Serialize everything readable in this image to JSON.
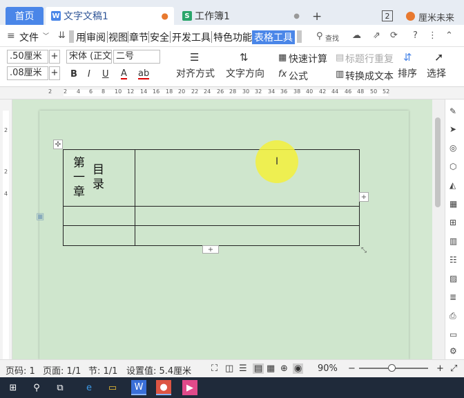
{
  "tabs": {
    "home": "首页",
    "doc": "文字文稿1",
    "sheet": "工作簿1",
    "add": "+",
    "window_count": "2",
    "user": "厘米未来"
  },
  "menu": {
    "file": "文件",
    "items": [
      "用",
      "审阅",
      "视图",
      "章节",
      "安全",
      "开发工具",
      "特色功能",
      "表格工具"
    ],
    "search": "查找"
  },
  "ribbon": {
    "height_field": ".50厘米",
    "width_field": ".08厘米",
    "font_name": "宋体 (正文)",
    "font_size": "二号",
    "bold": "B",
    "italic": "I",
    "underline": "U",
    "font_color": "A",
    "highlight": "ab",
    "align": "对齐方式",
    "direction": "文字方向",
    "quick_calc": "快速计算",
    "repeat_title": "标题行重复",
    "formula": "公式",
    "convert_text": "转换成文本",
    "sort": "排序",
    "select": "选择"
  },
  "ruler": {
    "h": [
      "2",
      "2",
      "4",
      "6",
      "8",
      "10",
      "12",
      "14",
      "16",
      "18",
      "20",
      "22",
      "24",
      "26",
      "28",
      "30",
      "32",
      "34",
      "36",
      "38",
      "40",
      "42",
      "44",
      "46",
      "48",
      "50",
      "52"
    ],
    "v": [
      "2",
      "2",
      "4"
    ]
  },
  "table": {
    "cell_col1": "第一章",
    "cell_col2": "目录"
  },
  "status": {
    "page_code": "页码: 1",
    "pages": "页面: 1/1",
    "section": "节: 1/1",
    "setting": "设置值: 5.4厘米",
    "zoom": "90%"
  },
  "colors": {
    "accent": "#4a86e8",
    "canvas": "#d3e8d1",
    "highlight": "#f3f03b",
    "taskbar": "#1f2a3a"
  }
}
